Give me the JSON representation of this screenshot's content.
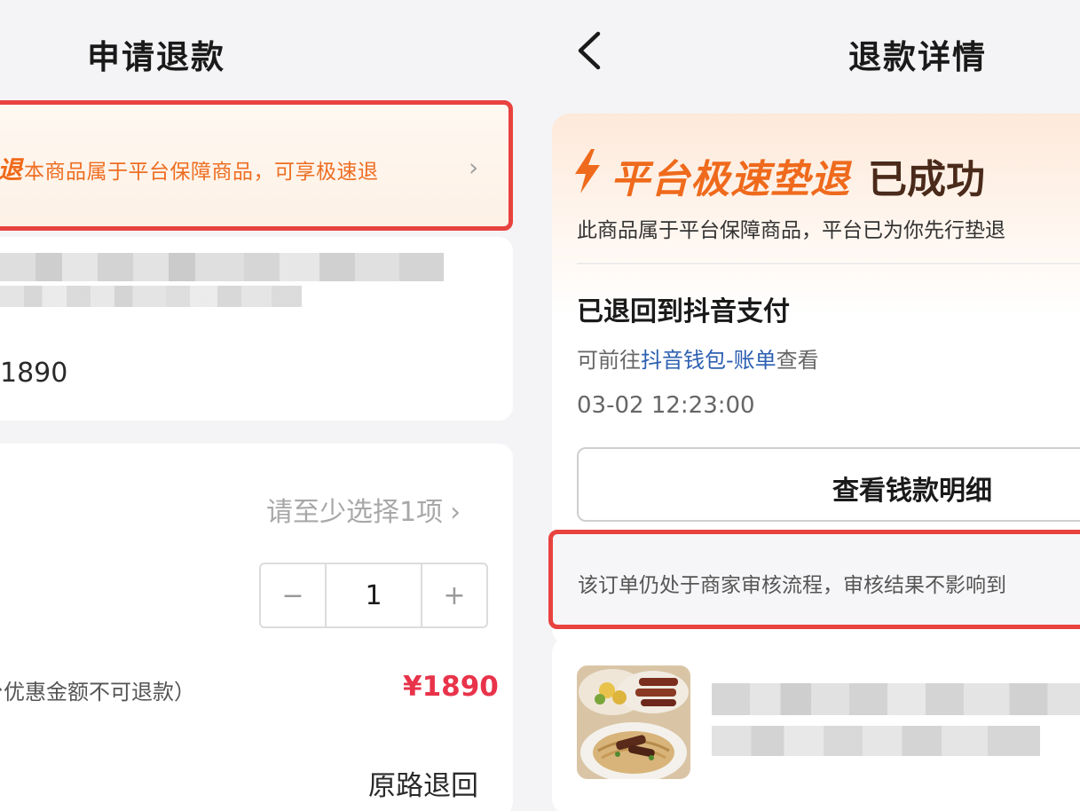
{
  "left": {
    "title": "申请退款",
    "banner": {
      "tag": "退",
      "text": "本商品属于平台保障商品，可享极速退",
      "chevron": "›"
    },
    "product": {
      "price_fragment": "1890"
    },
    "refund_form": {
      "select_hint": "请至少选择1项",
      "select_chevron": "›",
      "stepper": {
        "minus": "−",
        "value": "1",
        "plus": "+"
      },
      "note": "台优惠金额不可退款）",
      "amount": "¥1890",
      "method": "原路退回"
    }
  },
  "right": {
    "title": "退款详情",
    "back_icon": "chevron-left-icon",
    "success": {
      "headline": "平台极速垫退",
      "status": "已成功",
      "subtext": "此商品属于平台保障商品，平台已为你先行垫退",
      "refunded_to": "已退回到抖音支付",
      "goto_prefix": "可前往",
      "goto_link": "抖音钱包-账单",
      "goto_suffix": "查看",
      "timestamp": "03-02 12:23:00",
      "detail_button": "查看钱款明细"
    },
    "notice": "该订单仍处于商家审核流程，审核结果不影响到",
    "product_thumb": "food-photo"
  },
  "colors": {
    "accent_orange": "#ef6a1c",
    "highlight_red": "#e8423f",
    "price_red": "#e8334a",
    "link_blue": "#2c5fb0"
  }
}
